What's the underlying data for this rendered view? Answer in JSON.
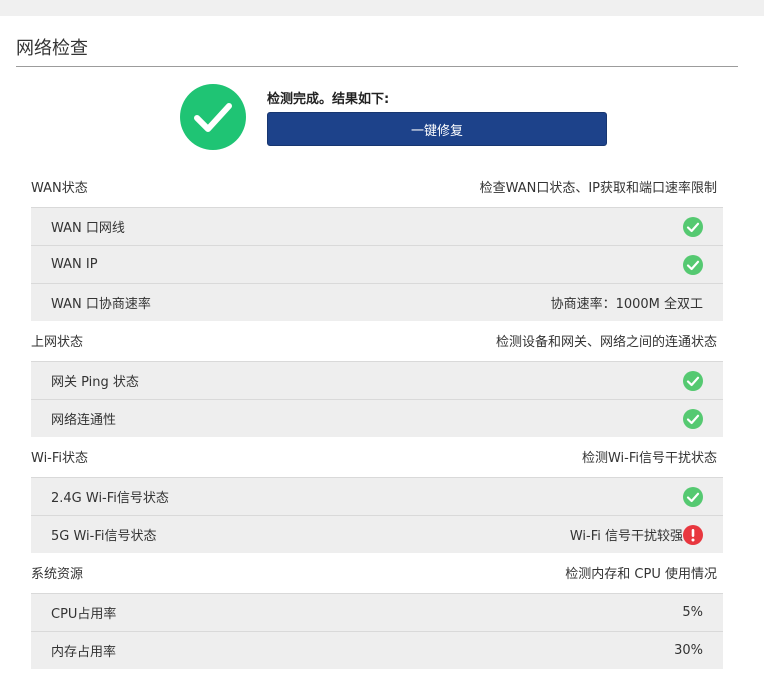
{
  "page": {
    "title": "网络检查"
  },
  "summary": {
    "result_text": "检测完成。结果如下:",
    "fix_button_label": "一键修复"
  },
  "colors": {
    "success": "#1fc474",
    "ok_icon": "#55c971",
    "warning": "#e8373f",
    "primary_button": "#1d428a",
    "row_background": "#eeeeee"
  },
  "sections": [
    {
      "title": "WAN状态",
      "description": "检查WAN口状态、IP获取和端口速率限制",
      "rows": [
        {
          "label": "WAN 口网线",
          "status": "ok",
          "status_icon": "check-circle-icon"
        },
        {
          "label": "WAN IP",
          "status": "ok",
          "status_icon": "check-circle-icon"
        },
        {
          "label": "WAN 口协商速率",
          "value": "协商速率：1000M 全双工"
        }
      ]
    },
    {
      "title": "上网状态",
      "description": "检测设备和网关、网络之间的连通状态",
      "rows": [
        {
          "label": "网关 Ping 状态",
          "status": "ok",
          "status_icon": "check-circle-icon"
        },
        {
          "label": "网络连通性",
          "status": "ok",
          "status_icon": "check-circle-icon"
        }
      ]
    },
    {
      "title": "Wi-Fi状态",
      "description": "检测Wi-Fi信号干扰状态",
      "rows": [
        {
          "label": "2.4G Wi-Fi信号状态",
          "status": "ok",
          "status_icon": "check-circle-icon"
        },
        {
          "label": "5G Wi-Fi信号状态",
          "value": "Wi-Fi 信号干扰较强",
          "status": "warning",
          "status_icon": "exclamation-circle-icon"
        }
      ]
    },
    {
      "title": "系统资源",
      "description": "检测内存和 CPU 使用情况",
      "rows": [
        {
          "label": "CPU占用率",
          "value": "5%"
        },
        {
          "label": "内存占用率",
          "value": "30%"
        }
      ]
    }
  ]
}
